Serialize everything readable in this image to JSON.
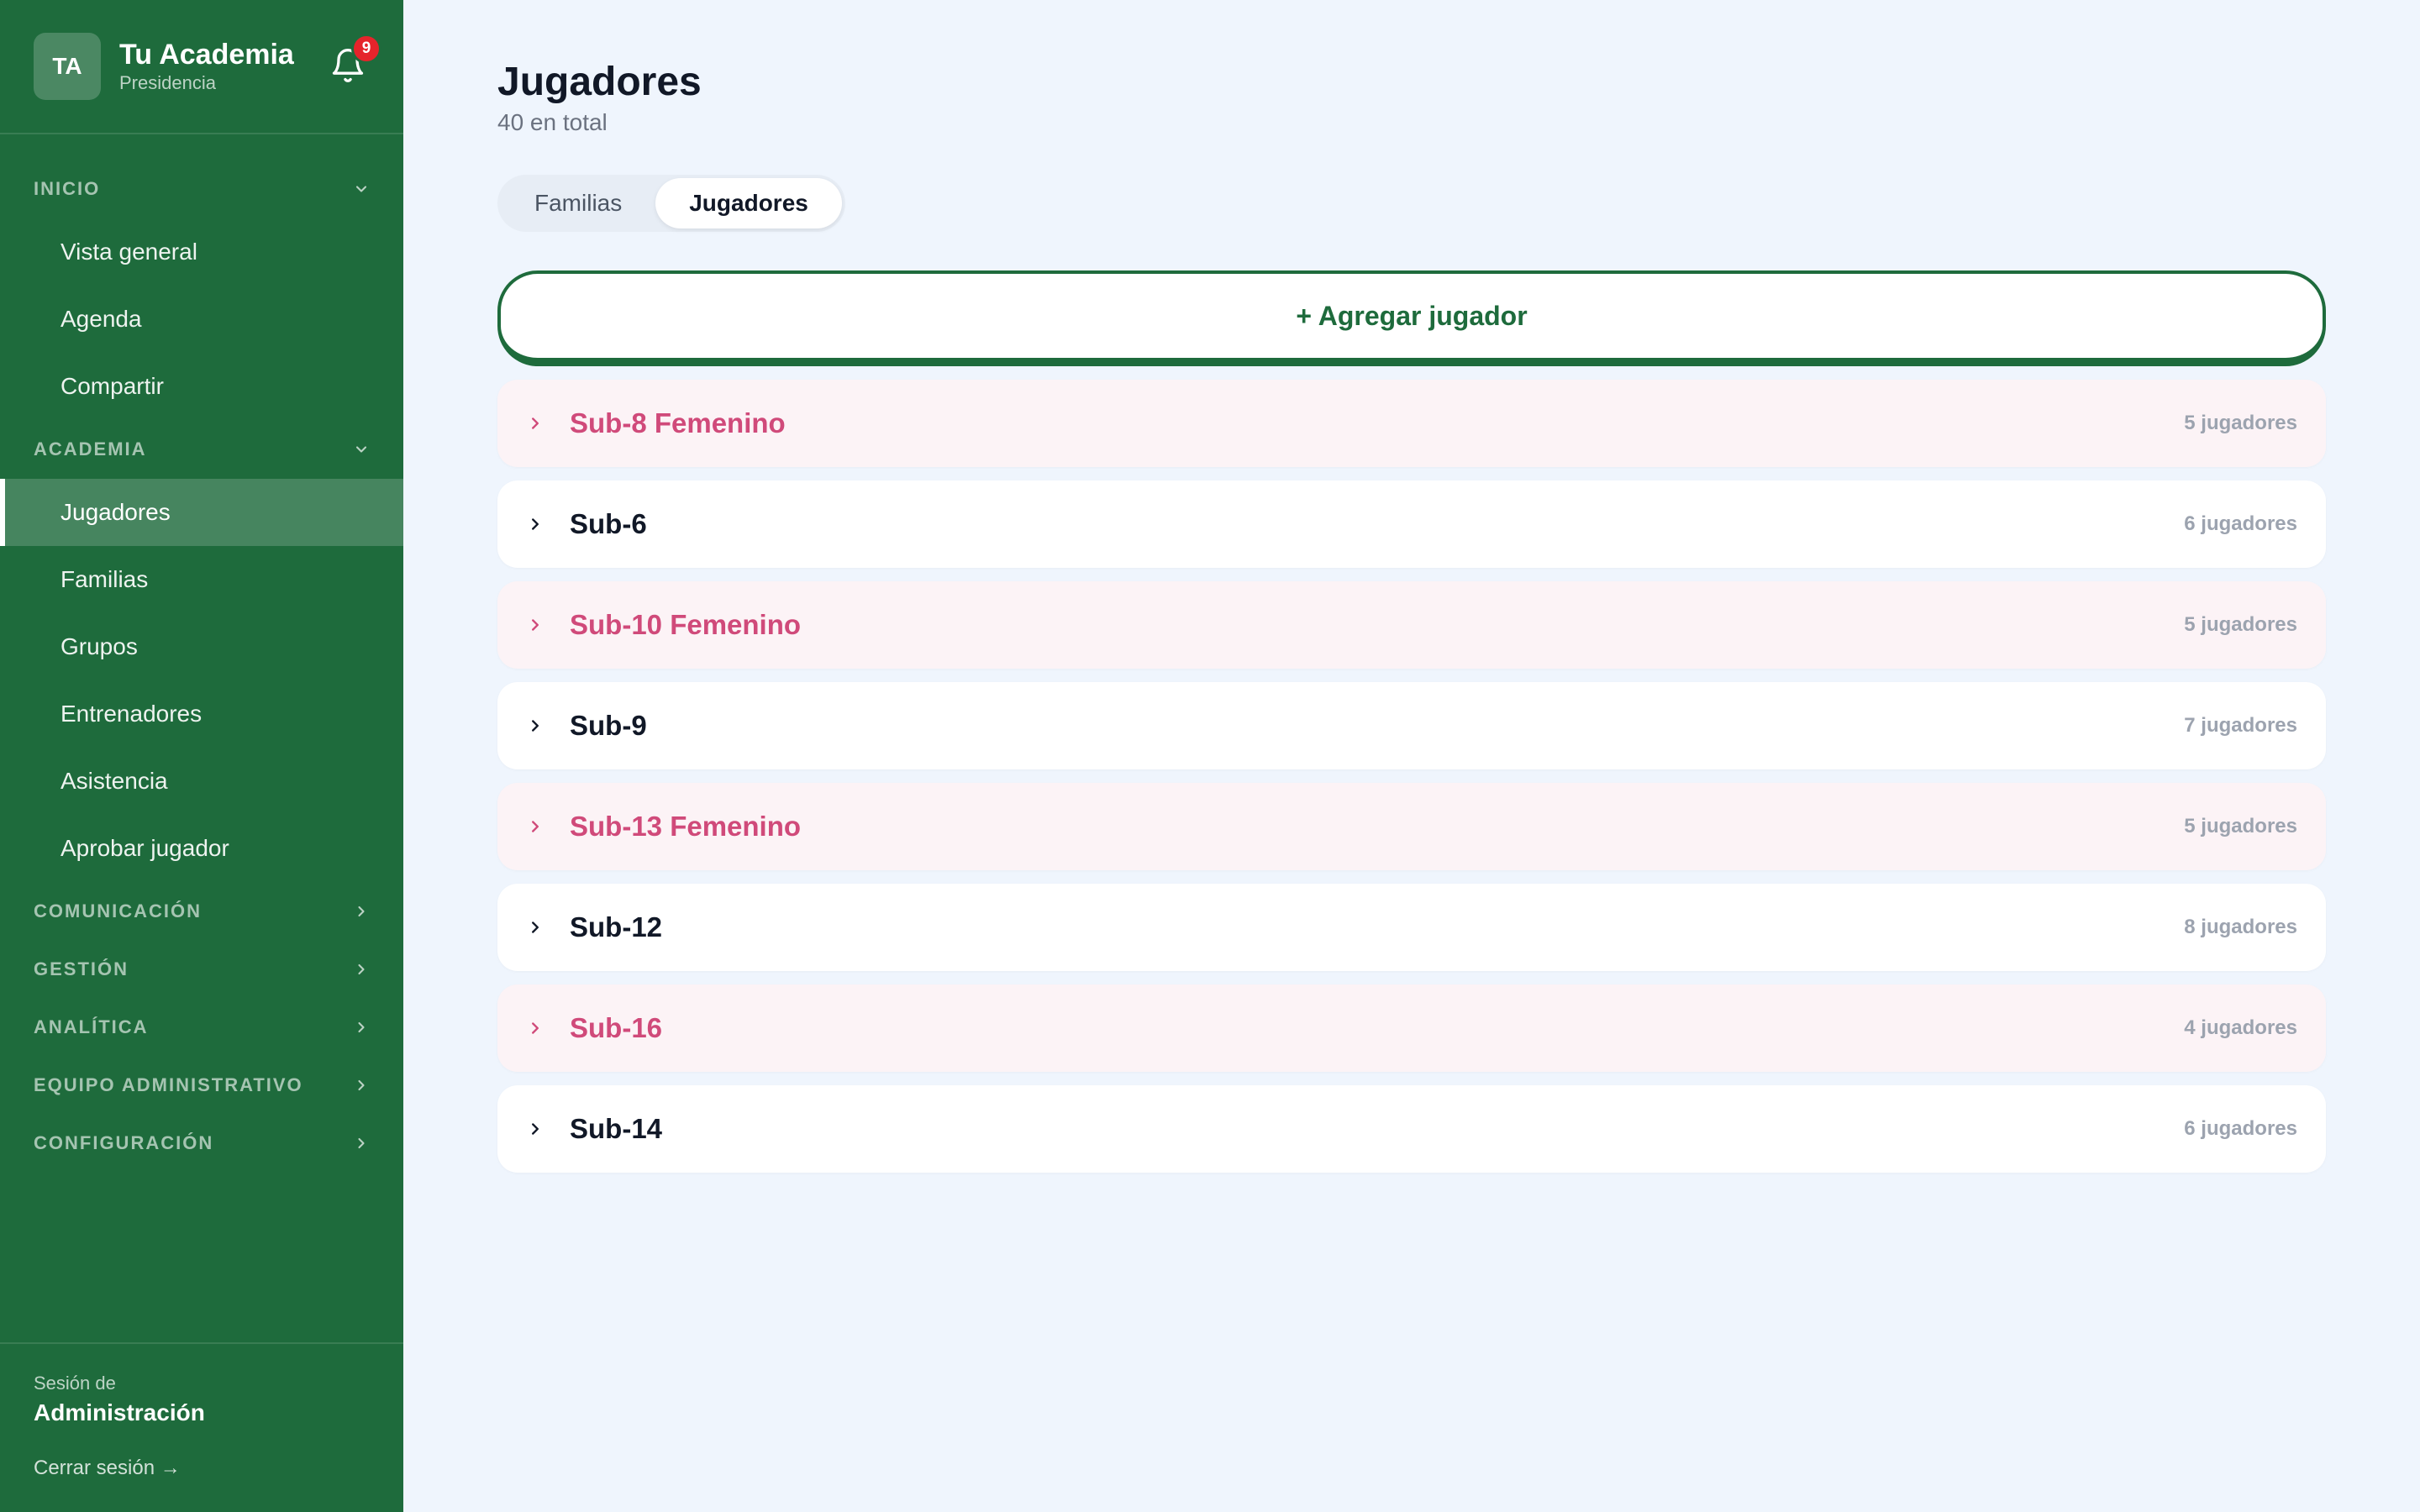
{
  "sidebar": {
    "avatar": "TA",
    "brand_name": "Tu Academia",
    "brand_sub": "Presidencia",
    "notifications": "9",
    "sections": {
      "inicio": "INICIO",
      "academia": "ACADEMIA",
      "comunicacion": "COMUNICACIÓN",
      "gestion": "GESTIÓN",
      "analitica": "ANALÍTICA",
      "equipo": "EQUIPO ADMINISTRATIVO",
      "configuracion": "CONFIGURACIÓN"
    },
    "inicio_items": [
      "Vista general",
      "Agenda",
      "Compartir"
    ],
    "academia_items": [
      "Jugadores",
      "Familias",
      "Grupos",
      "Entrenadores",
      "Asistencia",
      "Aprobar jugador"
    ],
    "active_item": "Jugadores",
    "session_label": "Sesión de",
    "session_name": "Administración",
    "logout": "Cerrar sesión →"
  },
  "main": {
    "title": "Jugadores",
    "subtitle": "40 en total",
    "tabs": [
      "Familias",
      "Jugadores"
    ],
    "active_tab": "Jugadores",
    "add_button": "+ Agregar jugador",
    "groups": [
      {
        "name": "Sub-8 Femenino",
        "count": "5 jugadores",
        "femenino": true
      },
      {
        "name": "Sub-6",
        "count": "6 jugadores",
        "femenino": false
      },
      {
        "name": "Sub-10 Femenino",
        "count": "5 jugadores",
        "femenino": true
      },
      {
        "name": "Sub-9",
        "count": "7 jugadores",
        "femenino": false
      },
      {
        "name": "Sub-13 Femenino",
        "count": "5 jugadores",
        "femenino": true
      },
      {
        "name": "Sub-12",
        "count": "8 jugadores",
        "femenino": false
      },
      {
        "name": "Sub-16",
        "count": "4 jugadores",
        "femenino": true
      },
      {
        "name": "Sub-14",
        "count": "6 jugadores",
        "femenino": false
      }
    ]
  },
  "colors": {
    "sidebar_bg": "#1e6b3c",
    "accent_green": "#1e6b3c",
    "femenino_text": "#d04a7a",
    "femenino_bg": "#fcf3f6",
    "badge_red": "#e5242b",
    "page_bg": "#eff5fd"
  },
  "icons": {
    "bell": "bell-icon",
    "section_open": "chevron-down-icon",
    "section_closed": "chevron-right-icon",
    "row_expand": "chevron-right-icon"
  }
}
